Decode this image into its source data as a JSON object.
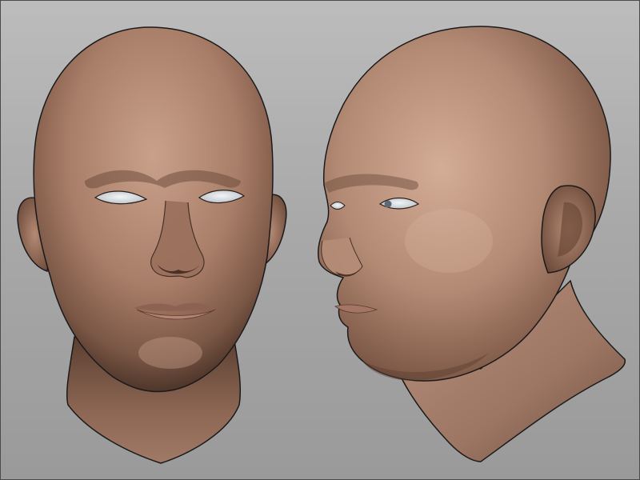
{
  "scene": {
    "subjects": [
      "front-view-head-render",
      "three-quarter-view-head-render"
    ],
    "colors": {
      "background_top": "#bcbcbc",
      "background_bottom": "#9a9a9a",
      "skin_light": "#c8a08a",
      "skin_mid": "#a87c66",
      "skin_shadow": "#5a3e30",
      "eye_white": "#e8ecef",
      "lips": "#b07e70",
      "outline": "#1a1a1a"
    }
  }
}
